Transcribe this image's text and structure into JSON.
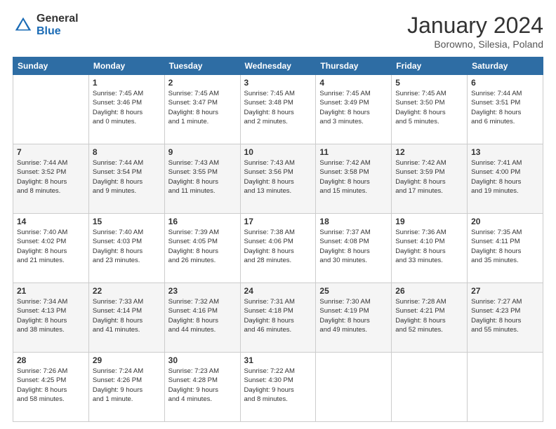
{
  "header": {
    "logo_general": "General",
    "logo_blue": "Blue",
    "title": "January 2024",
    "subtitle": "Borowno, Silesia, Poland"
  },
  "days_of_week": [
    "Sunday",
    "Monday",
    "Tuesday",
    "Wednesday",
    "Thursday",
    "Friday",
    "Saturday"
  ],
  "weeks": [
    [
      {
        "day": "",
        "info": ""
      },
      {
        "day": "1",
        "info": "Sunrise: 7:45 AM\nSunset: 3:46 PM\nDaylight: 8 hours\nand 0 minutes."
      },
      {
        "day": "2",
        "info": "Sunrise: 7:45 AM\nSunset: 3:47 PM\nDaylight: 8 hours\nand 1 minute."
      },
      {
        "day": "3",
        "info": "Sunrise: 7:45 AM\nSunset: 3:48 PM\nDaylight: 8 hours\nand 2 minutes."
      },
      {
        "day": "4",
        "info": "Sunrise: 7:45 AM\nSunset: 3:49 PM\nDaylight: 8 hours\nand 3 minutes."
      },
      {
        "day": "5",
        "info": "Sunrise: 7:45 AM\nSunset: 3:50 PM\nDaylight: 8 hours\nand 5 minutes."
      },
      {
        "day": "6",
        "info": "Sunrise: 7:44 AM\nSunset: 3:51 PM\nDaylight: 8 hours\nand 6 minutes."
      }
    ],
    [
      {
        "day": "7",
        "info": "Sunrise: 7:44 AM\nSunset: 3:52 PM\nDaylight: 8 hours\nand 8 minutes."
      },
      {
        "day": "8",
        "info": "Sunrise: 7:44 AM\nSunset: 3:54 PM\nDaylight: 8 hours\nand 9 minutes."
      },
      {
        "day": "9",
        "info": "Sunrise: 7:43 AM\nSunset: 3:55 PM\nDaylight: 8 hours\nand 11 minutes."
      },
      {
        "day": "10",
        "info": "Sunrise: 7:43 AM\nSunset: 3:56 PM\nDaylight: 8 hours\nand 13 minutes."
      },
      {
        "day": "11",
        "info": "Sunrise: 7:42 AM\nSunset: 3:58 PM\nDaylight: 8 hours\nand 15 minutes."
      },
      {
        "day": "12",
        "info": "Sunrise: 7:42 AM\nSunset: 3:59 PM\nDaylight: 8 hours\nand 17 minutes."
      },
      {
        "day": "13",
        "info": "Sunrise: 7:41 AM\nSunset: 4:00 PM\nDaylight: 8 hours\nand 19 minutes."
      }
    ],
    [
      {
        "day": "14",
        "info": "Sunrise: 7:40 AM\nSunset: 4:02 PM\nDaylight: 8 hours\nand 21 minutes."
      },
      {
        "day": "15",
        "info": "Sunrise: 7:40 AM\nSunset: 4:03 PM\nDaylight: 8 hours\nand 23 minutes."
      },
      {
        "day": "16",
        "info": "Sunrise: 7:39 AM\nSunset: 4:05 PM\nDaylight: 8 hours\nand 26 minutes."
      },
      {
        "day": "17",
        "info": "Sunrise: 7:38 AM\nSunset: 4:06 PM\nDaylight: 8 hours\nand 28 minutes."
      },
      {
        "day": "18",
        "info": "Sunrise: 7:37 AM\nSunset: 4:08 PM\nDaylight: 8 hours\nand 30 minutes."
      },
      {
        "day": "19",
        "info": "Sunrise: 7:36 AM\nSunset: 4:10 PM\nDaylight: 8 hours\nand 33 minutes."
      },
      {
        "day": "20",
        "info": "Sunrise: 7:35 AM\nSunset: 4:11 PM\nDaylight: 8 hours\nand 35 minutes."
      }
    ],
    [
      {
        "day": "21",
        "info": "Sunrise: 7:34 AM\nSunset: 4:13 PM\nDaylight: 8 hours\nand 38 minutes."
      },
      {
        "day": "22",
        "info": "Sunrise: 7:33 AM\nSunset: 4:14 PM\nDaylight: 8 hours\nand 41 minutes."
      },
      {
        "day": "23",
        "info": "Sunrise: 7:32 AM\nSunset: 4:16 PM\nDaylight: 8 hours\nand 44 minutes."
      },
      {
        "day": "24",
        "info": "Sunrise: 7:31 AM\nSunset: 4:18 PM\nDaylight: 8 hours\nand 46 minutes."
      },
      {
        "day": "25",
        "info": "Sunrise: 7:30 AM\nSunset: 4:19 PM\nDaylight: 8 hours\nand 49 minutes."
      },
      {
        "day": "26",
        "info": "Sunrise: 7:28 AM\nSunset: 4:21 PM\nDaylight: 8 hours\nand 52 minutes."
      },
      {
        "day": "27",
        "info": "Sunrise: 7:27 AM\nSunset: 4:23 PM\nDaylight: 8 hours\nand 55 minutes."
      }
    ],
    [
      {
        "day": "28",
        "info": "Sunrise: 7:26 AM\nSunset: 4:25 PM\nDaylight: 8 hours\nand 58 minutes."
      },
      {
        "day": "29",
        "info": "Sunrise: 7:24 AM\nSunset: 4:26 PM\nDaylight: 9 hours\nand 1 minute."
      },
      {
        "day": "30",
        "info": "Sunrise: 7:23 AM\nSunset: 4:28 PM\nDaylight: 9 hours\nand 4 minutes."
      },
      {
        "day": "31",
        "info": "Sunrise: 7:22 AM\nSunset: 4:30 PM\nDaylight: 9 hours\nand 8 minutes."
      },
      {
        "day": "",
        "info": ""
      },
      {
        "day": "",
        "info": ""
      },
      {
        "day": "",
        "info": ""
      }
    ]
  ]
}
